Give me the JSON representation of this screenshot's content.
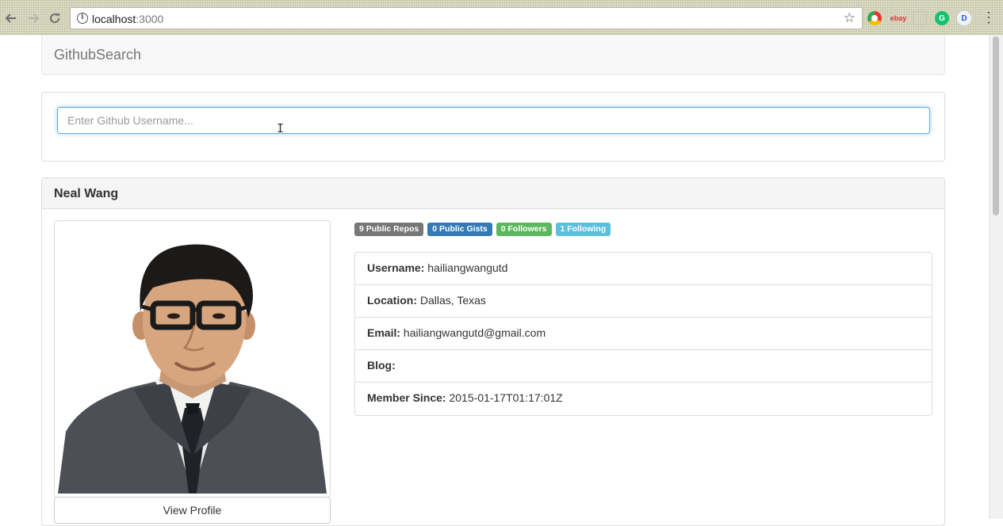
{
  "browser": {
    "url_host": "localhost",
    "url_port": ":3000"
  },
  "navbar": {
    "brand": "GithubSearch"
  },
  "search": {
    "placeholder": "Enter Github Username..."
  },
  "profile": {
    "name": "Neal Wang",
    "view_profile_label": "View Profile",
    "badges": [
      {
        "label": "9 Public Repos",
        "color": "#777777"
      },
      {
        "label": "0 Public Gists",
        "color": "#337ab7"
      },
      {
        "label": "0 Followers",
        "color": "#5cb85c"
      },
      {
        "label": "1 Following",
        "color": "#5bc0de"
      }
    ],
    "details": [
      {
        "label": "Username:",
        "value": "hailiangwangutd"
      },
      {
        "label": "Location:",
        "value": "Dallas, Texas"
      },
      {
        "label": "Email:",
        "value": "hailiangwangutd@gmail.com"
      },
      {
        "label": "Blog:",
        "value": ""
      },
      {
        "label": "Member Since:",
        "value": "2015-01-17T01:17:01Z"
      }
    ]
  },
  "icons": {
    "back": "back-arrow-icon",
    "forward": "forward-arrow-icon",
    "reload": "reload-icon",
    "info": "info-icon",
    "bookmark": "star-icon",
    "menu": "kebab-menu-icon",
    "text_cursor": "text-cursor-icon"
  }
}
